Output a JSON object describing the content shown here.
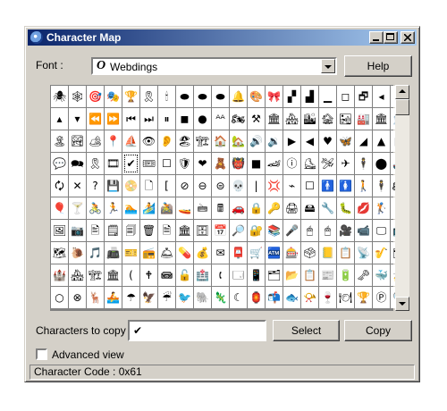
{
  "window": {
    "title": "Character Map",
    "title_colors": [
      "#0a246a",
      "#a6caf0"
    ],
    "controls": [
      "minimize-icon",
      "maximize-icon",
      "close-icon"
    ]
  },
  "font": {
    "label": "Font :",
    "icon_glyph": "O",
    "selected": "Webdings"
  },
  "buttons": {
    "help": "Help",
    "select": "Select",
    "copy": "Copy"
  },
  "grid": {
    "columns": 20,
    "selected_row": 3,
    "selected_col": 4,
    "rows": [
      [
        "🕷",
        "🕸",
        "🎯",
        "🎭",
        "🏆",
        "🎗",
        "🕯",
        "⬬",
        "⬬",
        "⬬",
        "🔔",
        "🎨",
        "🎀",
        "▞",
        "▟",
        "▁",
        "◻",
        "🗗",
        "◂",
        "▸"
      ],
      [
        "▴",
        "▾",
        "⏪",
        "⏩",
        "⏮",
        "⏭",
        "⏸",
        "◼",
        "●",
        "ᴬᴬ",
        "🏍",
        "⚒",
        "🏛",
        "🏘",
        "🏙",
        "🏚",
        "🏜",
        "🏭",
        "🏛",
        "🏦"
      ],
      [
        "🏝",
        "🏞",
        "🏕",
        "📍",
        "⛵",
        "👁",
        "👂",
        "🏖",
        "🏗",
        "🏠",
        "🏡",
        "🔊",
        "🔉",
        "▶",
        "◀",
        "♥",
        "🦋",
        "◢",
        "▲",
        "◣"
      ],
      [
        "💬",
        "🗪",
        "🎗",
        "🎞",
        "✔",
        "🎟",
        "☐",
        "🛡",
        "❤",
        "🧸",
        "👹",
        "■",
        "🏎",
        "ⓘ",
        "⛸",
        "🛩",
        "✈",
        "🕴",
        "⬤",
        "🚢"
      ],
      [
        "🗘",
        "✕",
        "?",
        "💾",
        "📀",
        "🗋",
        "[",
        "⊘",
        "⊖",
        "⊜",
        "💀",
        "|",
        "💢",
        "⌁",
        "☐",
        "🚹",
        "🚺",
        "🚶",
        "🕴",
        "🏍"
      ],
      [
        "🎈",
        "🍸",
        "🚴",
        "🏃",
        "🏊",
        "🏄",
        "🚵",
        "🚤",
        "🖮",
        "🖩",
        "🚗",
        "🔒",
        "🔑",
        "🖨",
        "🖴",
        "🔧",
        "🐛",
        "💋",
        "🏌",
        "🥊"
      ],
      [
        "🖼",
        "📷",
        "🖹",
        "🗒",
        "🗐",
        "🗑",
        "🗎",
        "🏛",
        "🗄",
        "📅",
        "🔎",
        "🔐",
        "📚",
        "🎤",
        "🖱",
        "🖱",
        "🎥",
        "📹",
        "🖵",
        "📺"
      ],
      [
        "🗺",
        "🐌",
        "🎵",
        "📠",
        "🎫",
        "📻",
        "🛎",
        "💊",
        "💰",
        "✉",
        "📮",
        "🛒",
        "🏧",
        "🎰",
        "🗳",
        "📒",
        "📋",
        "📡",
        "🎷",
        "🗂"
      ],
      [
        "🏰",
        "🏘",
        "🏗",
        "🏛",
        "(",
        "🕈",
        "📾",
        "🔓",
        "🏥",
        "🕻",
        "🗔",
        "📱",
        "🗂",
        "📂",
        "📋",
        "📰",
        "🔋",
        "🗝",
        "🐳",
        "🚁"
      ],
      [
        "○",
        "⊗",
        "🦌",
        "🚣",
        "☂",
        "🦅",
        "☔",
        "🐦",
        "🐘",
        "🦎",
        "☾",
        "🏮",
        "📬",
        "🐟",
        "📯",
        "🍷",
        "🍽",
        "🏆",
        "Ⓟ",
        "🔍"
      ]
    ]
  },
  "copy": {
    "label": "Characters to copy :",
    "value": "✔"
  },
  "advanced": {
    "label": "Advanced view",
    "checked": false
  },
  "status": {
    "text": "Character Code : 0x61"
  }
}
